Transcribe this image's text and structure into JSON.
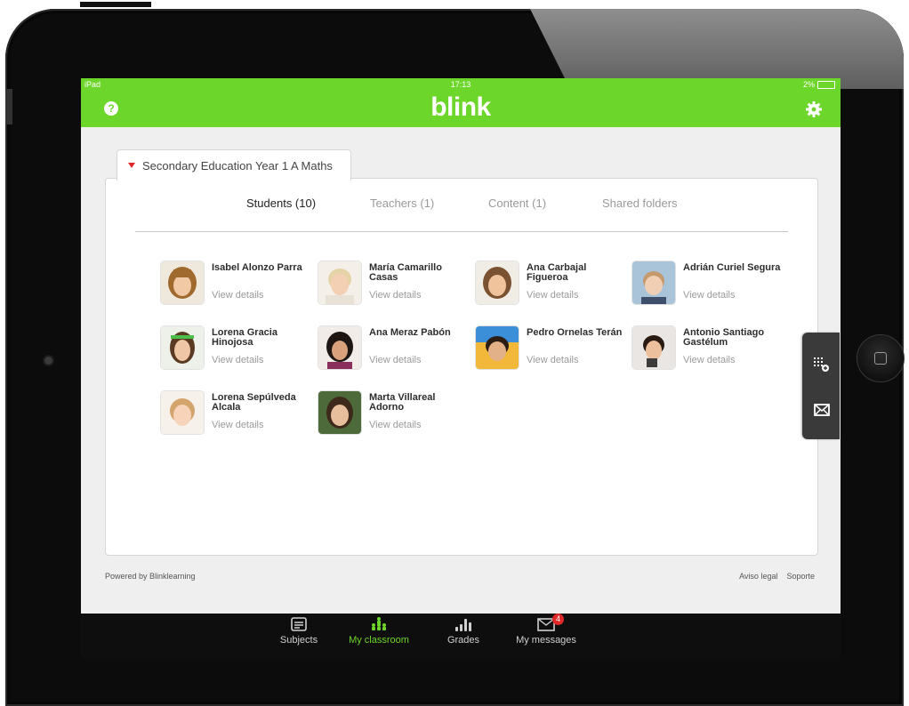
{
  "status": {
    "device": "iPad",
    "time": "17:13",
    "battery": "2%"
  },
  "brand": {
    "logo": "blink",
    "accent": "#6dd62a"
  },
  "class_tab": {
    "label": "Secondary Education Year 1 A Maths"
  },
  "tabs": [
    {
      "label": "Students (10)",
      "active": true
    },
    {
      "label": "Teachers (1)",
      "active": false
    },
    {
      "label": "Content (1)",
      "active": false
    },
    {
      "label": "Shared folders",
      "active": false
    }
  ],
  "students": [
    {
      "name": "Isabel Alonzo Parra",
      "link": "View details"
    },
    {
      "name": "María Camarillo Casas",
      "link": "View details"
    },
    {
      "name": "Ana Carbajal Figueroa",
      "link": "View details"
    },
    {
      "name": "Adrián Curiel Segura",
      "link": "View details"
    },
    {
      "name": "Lorena Gracia Hinojosa",
      "link": "View details"
    },
    {
      "name": "Ana Meraz Pabón",
      "link": "View details"
    },
    {
      "name": "Pedro Ornelas Terán",
      "link": "View details"
    },
    {
      "name": "Antonio Santiago Gastélum",
      "link": "View details"
    },
    {
      "name": "Lorena Sepúlveda Alcala",
      "link": "View details"
    },
    {
      "name": "Marta Villareal Adorno",
      "link": "View details"
    }
  ],
  "footer": {
    "powered": "Powered by Blinklearning",
    "legal": "Aviso legal",
    "support": "Soporte"
  },
  "bottom_nav": [
    {
      "label": "Subjects",
      "icon": "folder-icon",
      "active": false
    },
    {
      "label": "My classroom",
      "icon": "classroom-icon",
      "active": true
    },
    {
      "label": "Grades",
      "icon": "grades-icon",
      "active": false
    },
    {
      "label": "My messages",
      "icon": "envelope-icon",
      "active": false,
      "badge": "4"
    }
  ]
}
